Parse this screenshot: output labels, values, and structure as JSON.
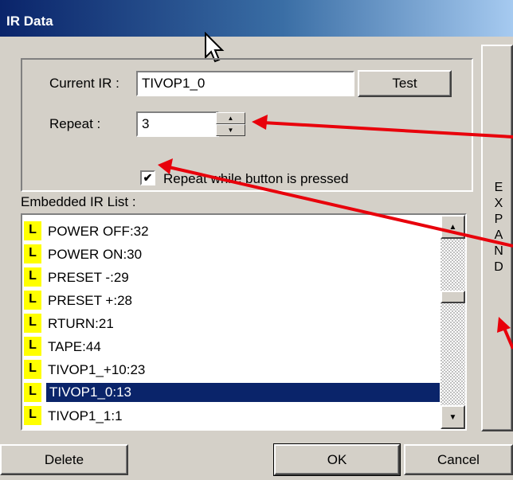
{
  "window": {
    "title": "IR Data"
  },
  "current_ir": {
    "label": "Current IR :",
    "value": "TIVOP1_0",
    "test_label": "Test"
  },
  "repeat": {
    "label": "Repeat :",
    "value": "3"
  },
  "repeat_while_pressed": {
    "label": "Repeat while button is pressed",
    "checked": true
  },
  "list": {
    "label": "Embedded IR List :",
    "badge": "L",
    "items": [
      "POWER OFF:32",
      "POWER ON:30",
      "PRESET -:29",
      "PRESET +:28",
      "RTURN:21",
      "TAPE:44",
      "TIVOP1_+10:23",
      "TIVOP1_0:13",
      "TIVOP1_1:1"
    ],
    "selected_index": 7
  },
  "expand": {
    "letters": [
      "E",
      "X",
      "P",
      "A",
      "N",
      "D"
    ]
  },
  "buttons": {
    "delete": "Delete",
    "ok": "OK",
    "cancel": "Cancel"
  },
  "colors": {
    "title_start": "#0a246a",
    "selection": "#0a246a",
    "badge": "#ffff00",
    "annotation_arrow": "#e8000b"
  }
}
